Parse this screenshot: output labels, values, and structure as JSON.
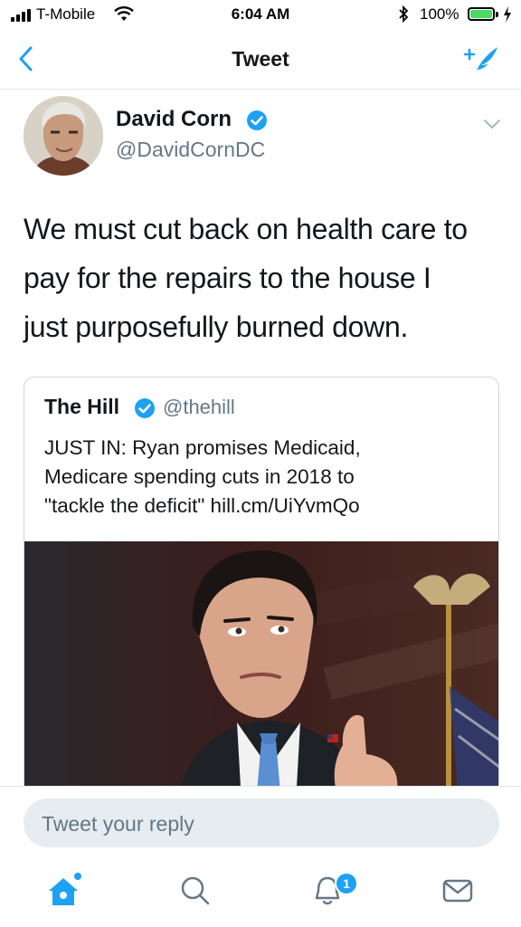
{
  "status_bar": {
    "carrier": "T-Mobile",
    "time": "6:04 AM",
    "battery": "100%"
  },
  "nav": {
    "title": "Tweet",
    "back_icon": "chevron-left-icon",
    "compose_icon": "compose-tweet-icon"
  },
  "tweet": {
    "author_name": "David Corn",
    "author_handle": "@DavidCornDC",
    "text_lines": [
      "We must cut back on health care to",
      "pay for the repairs to the house I",
      "just purposefully burned down."
    ],
    "quoted": {
      "name": "The Hill",
      "handle": "@thehill",
      "text_lines": [
        "JUST IN: Ryan promises Medicaid,",
        "Medicare spending cuts in 2018 to",
        "\"tackle the deficit\" hill.cm/UiYvmQo"
      ]
    }
  },
  "reply": {
    "placeholder": "Tweet your reply"
  },
  "tabs": {
    "notifications_badge": "1"
  },
  "colors": {
    "accent": "#1da1f2",
    "text": "#14171a",
    "secondary": "#657786",
    "border": "#e1e8ed"
  }
}
